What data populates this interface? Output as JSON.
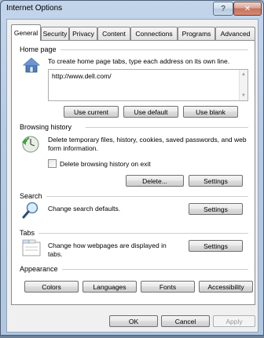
{
  "window": {
    "title": "Internet Options",
    "help_glyph": "?",
    "close_glyph": "✕"
  },
  "tabs": [
    "General",
    "Security",
    "Privacy",
    "Content",
    "Connections",
    "Programs",
    "Advanced"
  ],
  "active_tab": "General",
  "home_page": {
    "label": "Home page",
    "description": "To create home page tabs, type each address on its own line.",
    "value": "http://www.dell.com/",
    "buttons": {
      "use_current": "Use current",
      "use_default": "Use default",
      "use_blank": "Use blank"
    },
    "icon": "home-icon"
  },
  "browsing_history": {
    "label": "Browsing history",
    "description": "Delete temporary files, history, cookies, saved passwords, and web form information.",
    "checkbox_label": "Delete browsing history on exit",
    "checkbox_checked": false,
    "buttons": {
      "delete": "Delete...",
      "settings": "Settings"
    },
    "icon": "history-icon"
  },
  "search": {
    "label": "Search",
    "description": "Change search defaults.",
    "buttons": {
      "settings": "Settings"
    },
    "icon": "magnifier-icon"
  },
  "tabs_section": {
    "label": "Tabs",
    "description": "Change how webpages are displayed in tabs.",
    "buttons": {
      "settings": "Settings"
    },
    "icon": "tabs-icon"
  },
  "appearance": {
    "label": "Appearance",
    "buttons": {
      "colors": "Colors",
      "languages": "Languages",
      "fonts": "Fonts",
      "accessibility": "Accessibility"
    }
  },
  "footer": {
    "ok": "OK",
    "cancel": "Cancel",
    "apply": "Apply"
  }
}
